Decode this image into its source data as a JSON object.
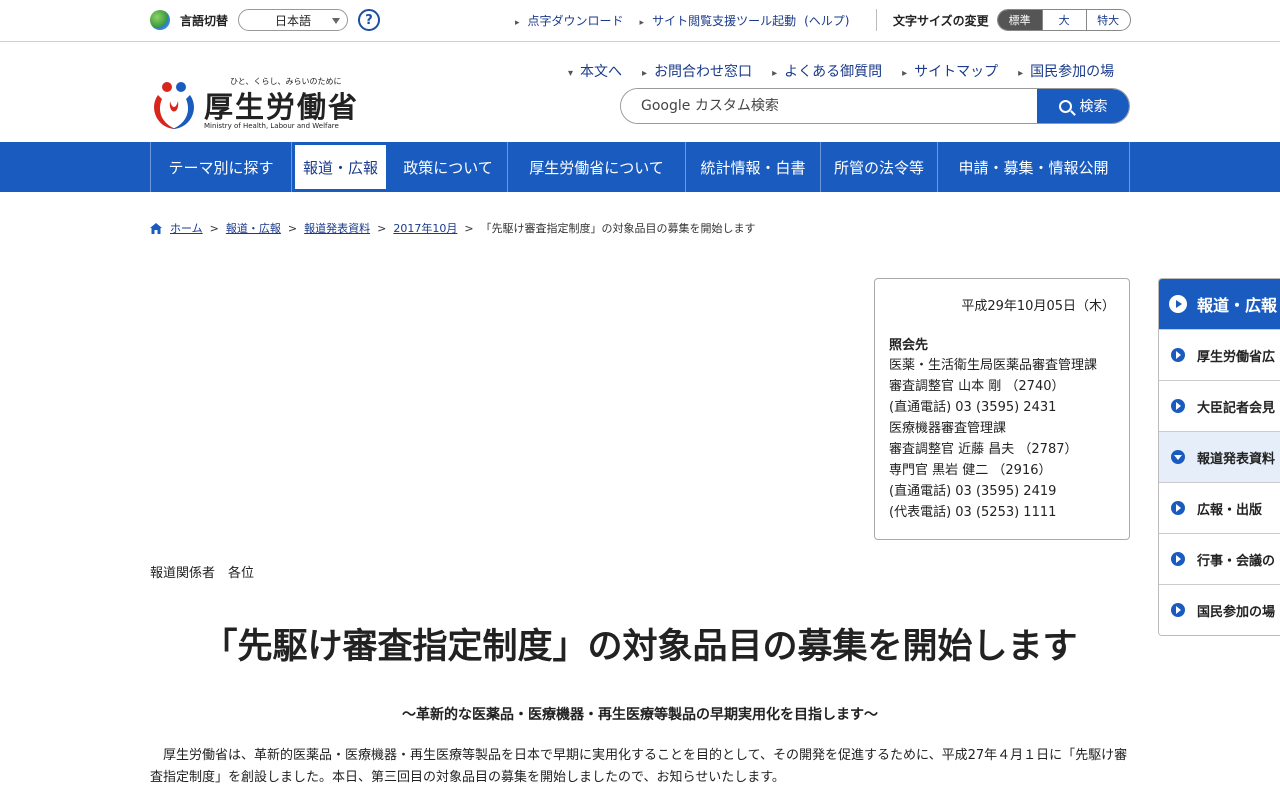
{
  "topbar": {
    "language_label": "言語切替",
    "language_selected": "日本語",
    "help_label": "?",
    "links": [
      "点字ダウンロード",
      "サイト閲覧支援ツール起動",
      "(ヘルプ)"
    ],
    "font_size_label": "文字サイズの変更",
    "font_sizes": [
      "標準",
      "大",
      "特大"
    ]
  },
  "header": {
    "logo_tagline": "ひと、くらし、みらいのために",
    "logo_name": "厚生労働省",
    "logo_en": "Ministry of Health, Labour and Welfare",
    "links": [
      "本文へ",
      "お問合わせ窓口",
      "よくある御質問",
      "サイトマップ",
      "国民参加の場"
    ],
    "search_placeholder": "Google カスタム検索",
    "search_button": "検索"
  },
  "gnav": [
    {
      "label": "テーマ別に探す"
    },
    {
      "label": "報道・広報"
    },
    {
      "label": "政策について"
    },
    {
      "label": "厚生労働省について"
    },
    {
      "label": "統計情報・白書"
    },
    {
      "label": "所管の法令等"
    },
    {
      "label": "申請・募集・情報公開"
    }
  ],
  "breadcrumb": {
    "items": [
      "ホーム",
      "報道・広報",
      "報道発表資料",
      "2017年10月"
    ],
    "current": "「先駆け審査指定制度」の対象品目の募集を開始します"
  },
  "contact": {
    "date": "平成29年10月05日（木）",
    "heading": "照会先",
    "lines": [
      "医薬・生活衛生局医薬品審査管理課",
      "審査調整官 山本 剛 （2740）",
      "(直通電話) 03 (3595) 2431",
      "医療機器審査管理課",
      "審査調整官 近藤 昌夫 （2787）",
      "専門官 黒岩 健二 （2916）",
      "(直通電話) 03 (3595) 2419",
      "(代表電話) 03 (5253) 1111"
    ]
  },
  "article": {
    "addressee": "報道関係者　各位",
    "title": "「先駆け審査指定制度」の対象品目の募集を開始します",
    "subtitle": "～革新的な医薬品・医療機器・再生医療等製品の早期実用化を目指します～",
    "body": "厚生労働省は、革新的医薬品・医療機器・再生医療等製品を日本で早期に実用化することを目的として、その開発を促進するために、平成27年４月１日に「先駆け審査指定制度」を創設しました。本日、第三回目の対象品目の募集を開始しましたので、お知らせいたします。"
  },
  "sidenav": {
    "title": "報道・広報",
    "items": [
      "厚生労働省広",
      "大臣記者会見",
      "報道発表資料",
      "広報・出版",
      "行事・会議の",
      "国民参加の場"
    ]
  },
  "colors": {
    "primary": "#1a5bbf",
    "link": "#1a3a8a"
  }
}
